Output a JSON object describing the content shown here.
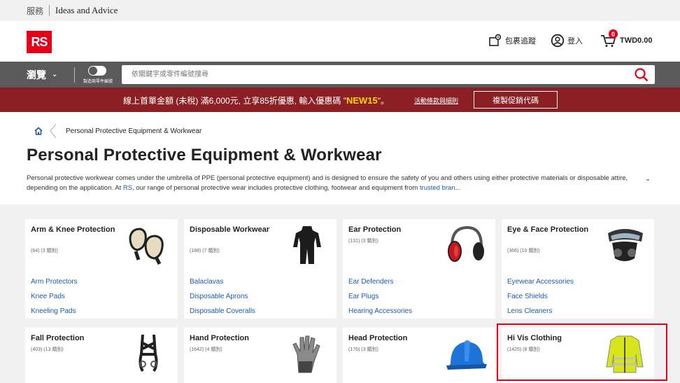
{
  "topbar": {
    "service": "服務",
    "ideas": "Ideas and Advice"
  },
  "header": {
    "logo": "RS",
    "parcel_tracking": "包裹追蹤",
    "login": "登入",
    "cart_count": "0",
    "cart_total": "TWD0.00"
  },
  "nav": {
    "browse": "瀏覽",
    "toggle_label": "製造商零件編號",
    "search_placeholder": "依關鍵字或零件編號搜尋"
  },
  "promo": {
    "text_before": "線上首單金額 (未稅) 滿6,000元, 立享85折優惠, 輸入優惠碼 \"",
    "code": "NEW15",
    "text_after": "\"。",
    "terms_link": "活動條款與細則",
    "copy_button": "複製促銷代碼"
  },
  "breadcrumb": {
    "current": "Personal Protective Equipment & Workwear"
  },
  "page": {
    "title": "Personal Protective Equipment & Workwear",
    "desc_1": "Personal protective workwear comes under the umbrella of PPE (personal protective equipment) and is designed to ensure the safety of you and others using either protective materials or disposable attire, depending on the application. At ",
    "desc_rs": "RS",
    "desc_2": ", our range of personal protective wear includes protective clothing, footwear and equipment from ",
    "desc_link": "trusted bran..."
  },
  "categories": [
    {
      "title": "Arm & Knee Protection",
      "count": "(64) (3 類別)",
      "links": [
        "Arm Protectors",
        "Knee Pads",
        "Kneeling Pads"
      ]
    },
    {
      "title": "Disposable Workwear",
      "count": "(188) (7 類別)",
      "links": [
        "Balaclavas",
        "Disposable Aprons",
        "Disposable Coveralls"
      ]
    },
    {
      "title": "Ear Protection",
      "count": "(131) (3 類別)",
      "links": [
        "Ear Defenders",
        "Ear Plugs",
        "Hearing Accessories"
      ]
    },
    {
      "title": "Eye & Face Protection",
      "count": "(366) (10 類別)",
      "links": [
        "Eyewear Accessories",
        "Face Shields",
        "Lens Cleaners"
      ]
    },
    {
      "title": "Fall Protection",
      "count": "(403) (13 類別)",
      "links": []
    },
    {
      "title": "Hand Protection",
      "count": "(1642) (4 類別)",
      "links": []
    },
    {
      "title": "Head Protection",
      "count": "(176) (3 類別)",
      "links": []
    },
    {
      "title": "Hi Vis Clothing",
      "count": "(1425) (8 類別)",
      "links": []
    }
  ],
  "colors": {
    "brand_red": "#e2001a",
    "promo_bg": "#8b1f24",
    "nav_bg": "#5a5a5a",
    "link": "#1e5aa8",
    "promo_code": "#ffd400"
  }
}
